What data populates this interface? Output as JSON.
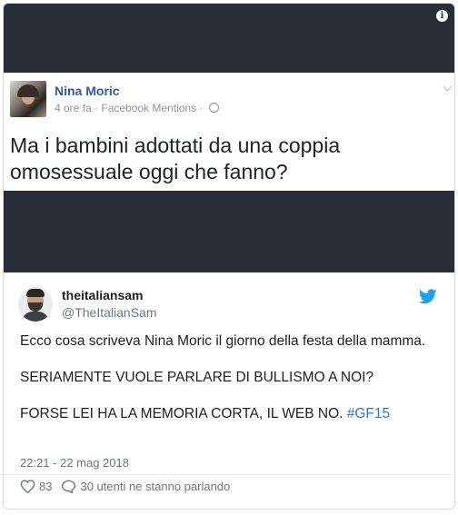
{
  "facebook_post": {
    "name": "Nina Moric",
    "meta": "4 ore fa · Facebook Mentions · ",
    "text": "Ma i bambini adottati da una coppia omosessuale oggi che fanno?"
  },
  "tweet": {
    "name": "theitaliansam",
    "handle": "@TheItalianSam",
    "paragraphs": [
      "Ecco cosa scriveva Nina Moric il giorno della festa della mamma.",
      "SERIAMENTE VUOLE PARLARE DI BULLISMO A NOI?",
      "FORSE LEI HA LA MEMORIA CORTA, IL WEB NO. "
    ],
    "hashtag": "#GF15",
    "timestamp": "22:21 - 22 mag 2018",
    "likes": "83",
    "replies_text": "30 utenti ne stanno parlando"
  },
  "icons": {
    "info": "info-icon",
    "globe": "globe-icon",
    "twitter": "twitter-bird-icon",
    "like": "heart-icon",
    "reply": "speech-bubble-icon"
  },
  "colors": {
    "media_bg": "#2a2f37",
    "facebook_name": "#365899",
    "twitter_blue": "#1da1f2",
    "hashtag": "#2b7bb9",
    "muted": "#697882"
  }
}
